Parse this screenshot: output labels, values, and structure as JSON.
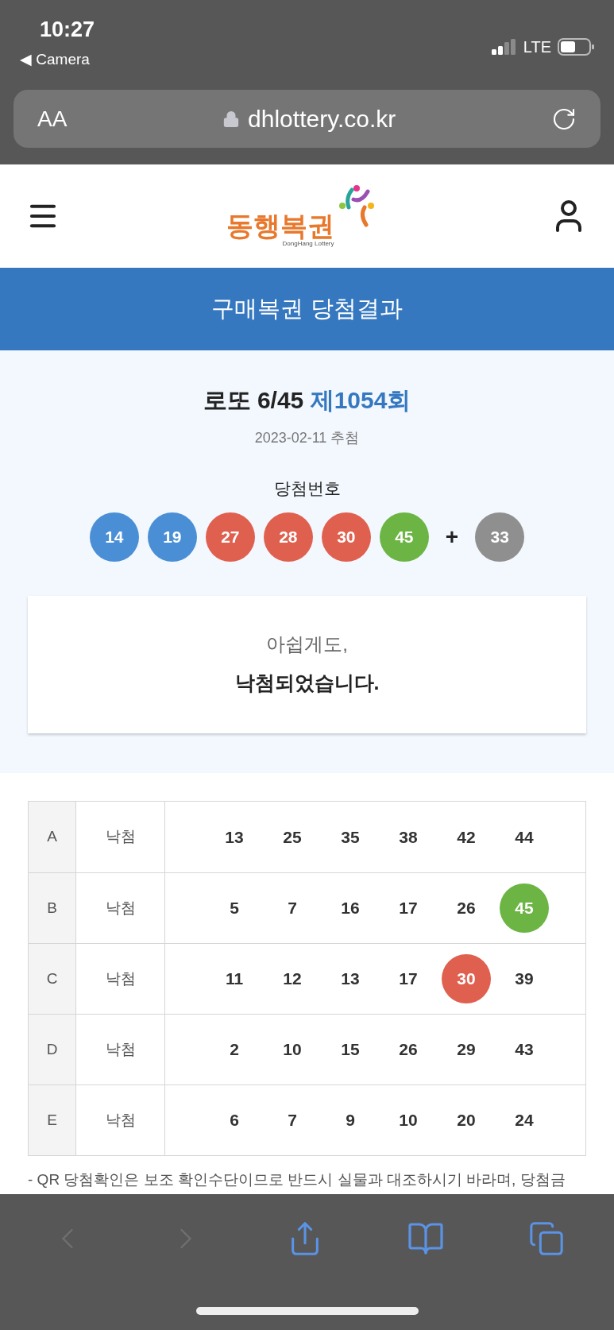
{
  "status_bar": {
    "time": "10:27",
    "back_app": "◀ Camera",
    "network": "LTE"
  },
  "browser": {
    "text_size": "AA",
    "url": "dhlottery.co.kr"
  },
  "site_header": {
    "logo_text": "동행복권",
    "logo_subtext": "DongHang Lottery"
  },
  "banner": {
    "title": "구매복권 당첨결과"
  },
  "draw": {
    "game": "로또 6/45",
    "round": "제1054회",
    "date": "2023-02-11 추첨",
    "numbers_label": "당첨번호",
    "balls": [
      {
        "value": "14",
        "color": "#4a8fd6"
      },
      {
        "value": "19",
        "color": "#4a8fd6"
      },
      {
        "value": "27",
        "color": "#e0604f"
      },
      {
        "value": "28",
        "color": "#e0604f"
      },
      {
        "value": "30",
        "color": "#e0604f"
      },
      {
        "value": "45",
        "color": "#6cb545"
      }
    ],
    "plus": "+",
    "bonus": {
      "value": "33",
      "color": "#8f8f8f"
    }
  },
  "result": {
    "line_1": "아쉽게도,",
    "line_2": "낙첨되었습니다."
  },
  "table": {
    "rows": [
      {
        "game": "A",
        "result": "낙첨",
        "numbers": [
          {
            "value": "13",
            "matched": false
          },
          {
            "value": "25",
            "matched": false
          },
          {
            "value": "35",
            "matched": false
          },
          {
            "value": "38",
            "matched": false
          },
          {
            "value": "42",
            "matched": false
          },
          {
            "value": "44",
            "matched": false
          }
        ]
      },
      {
        "game": "B",
        "result": "낙첨",
        "numbers": [
          {
            "value": "5",
            "matched": false
          },
          {
            "value": "7",
            "matched": false
          },
          {
            "value": "16",
            "matched": false
          },
          {
            "value": "17",
            "matched": false
          },
          {
            "value": "26",
            "matched": false
          },
          {
            "value": "45",
            "matched": true,
            "color": "#6cb545"
          }
        ]
      },
      {
        "game": "C",
        "result": "낙첨",
        "numbers": [
          {
            "value": "11",
            "matched": false
          },
          {
            "value": "12",
            "matched": false
          },
          {
            "value": "13",
            "matched": false
          },
          {
            "value": "17",
            "matched": false
          },
          {
            "value": "30",
            "matched": true,
            "color": "#e0604f"
          },
          {
            "value": "39",
            "matched": false
          }
        ]
      },
      {
        "game": "D",
        "result": "낙첨",
        "numbers": [
          {
            "value": "2",
            "matched": false
          },
          {
            "value": "10",
            "matched": false
          },
          {
            "value": "15",
            "matched": false
          },
          {
            "value": "26",
            "matched": false
          },
          {
            "value": "29",
            "matched": false
          },
          {
            "value": "43",
            "matched": false
          }
        ]
      },
      {
        "game": "E",
        "result": "낙첨",
        "numbers": [
          {
            "value": "6",
            "matched": false
          },
          {
            "value": "7",
            "matched": false
          },
          {
            "value": "9",
            "matched": false
          },
          {
            "value": "10",
            "matched": false
          },
          {
            "value": "20",
            "matched": false
          },
          {
            "value": "24",
            "matched": false
          }
        ]
      }
    ]
  },
  "note": "- QR 당첨확인은 보조 확인수단이므로 반드시 실물과 대조하시기 바라며, 당첨금",
  "toolbar": {
    "back_enabled": false,
    "forward_enabled": false
  }
}
